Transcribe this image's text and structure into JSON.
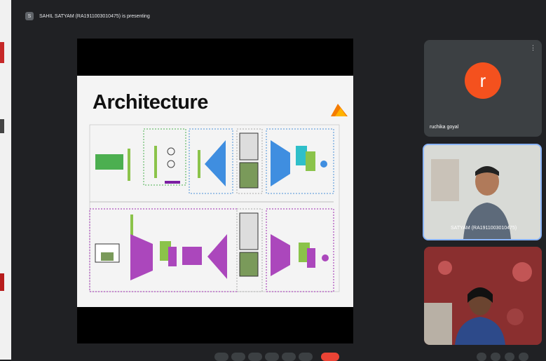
{
  "presenter": {
    "banner": "SAHIL SATYAM (RA1911003010475) is presenting",
    "chip": "S"
  },
  "slide": {
    "title": "Architecture"
  },
  "participants": [
    {
      "name": "ruchika goyal",
      "avatar_letter": "r",
      "avatar_color": "#f4511e"
    },
    {
      "name": "SATYAM (RA1911003010475)"
    },
    {
      "name": ""
    }
  ],
  "colors": {
    "background": "#202124",
    "tile": "#3c4043",
    "accent": "#8ab4f8",
    "end_call": "#ea4335"
  }
}
